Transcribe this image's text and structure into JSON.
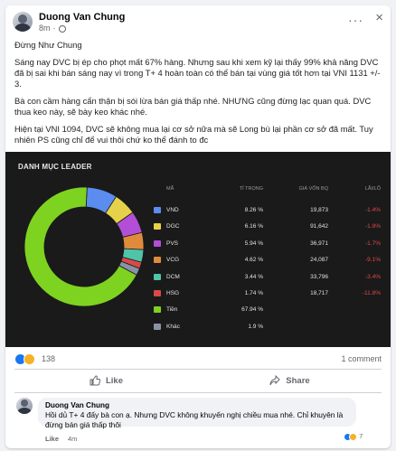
{
  "post": {
    "author": "Duong Van Chung",
    "time": "8m",
    "more": "···",
    "close": "×",
    "paragraphs": [
      "Đừng Như Chung",
      "Sáng nay DVC bị ép cho phọt mất 67% hàng. Nhưng sau khi xem kỹ lại thấy 99% khả năng DVC đã bị sai khi bán sáng nay vì trong T+ 4 hoàn toàn có thể bán tại vùng giá tốt hơn tại VNI 1131 +/- 3.",
      "Bà con cầm hàng cẩn thận bị sói lừa bán giá thấp nhé. NHƯNG cũng đừng lạc quan quá. DVC thua keo này, sẽ bày keo khác nhé.",
      "Hiện tại VNI 1094, DVC sẽ không mua lại cơ sở nữa mà sẽ Long bù lại phần cơ sở đã mất. Tuy nhiên PS cũng chỉ để vui thôi chứ ko thể đánh to đc"
    ]
  },
  "portfolio": {
    "title": "DANH MỤC LEADER",
    "headers": {
      "code": "MÃ",
      "weight": "TỈ TRỌNG",
      "price": "GIÁ VỐN BQ",
      "pl": "LÃI/LỖ"
    },
    "rows": [
      {
        "code": "VND",
        "weight": "8.26 %",
        "price": "19,873",
        "pl": "-1.4%",
        "color": "#5b8cf0"
      },
      {
        "code": "DGC",
        "weight": "6.16 %",
        "price": "91,642",
        "pl": "-1.8%",
        "color": "#e6d24a"
      },
      {
        "code": "PVS",
        "weight": "5.94 %",
        "price": "36,971",
        "pl": "-1.7%",
        "color": "#b24fd6"
      },
      {
        "code": "VCG",
        "weight": "4.62 %",
        "price": "24,087",
        "pl": "-9.1%",
        "color": "#e08a3c"
      },
      {
        "code": "DCM",
        "weight": "3.44 %",
        "price": "33,796",
        "pl": "-3.4%",
        "color": "#4fc4a8"
      },
      {
        "code": "HSG",
        "weight": "1.74 %",
        "price": "18,717",
        "pl": "-11.8%",
        "color": "#d84a4a"
      },
      {
        "code": "Tiền",
        "weight": "67.94 %",
        "price": "",
        "pl": "",
        "color": "#7ed321"
      },
      {
        "code": "Khác",
        "weight": "1.9 %",
        "price": "",
        "pl": "",
        "color": "#8a93a6"
      }
    ]
  },
  "chart_data": {
    "type": "pie",
    "title": "DANH MỤC LEADER",
    "categories": [
      "VND",
      "DGC",
      "PVS",
      "VCG",
      "DCM",
      "HSG",
      "Tiền",
      "Khác"
    ],
    "values": [
      8.26,
      6.16,
      5.94,
      4.62,
      3.44,
      1.74,
      67.94,
      1.9
    ],
    "colors": [
      "#5b8cf0",
      "#e6d24a",
      "#b24fd6",
      "#e08a3c",
      "#4fc4a8",
      "#d84a4a",
      "#7ed321",
      "#8a93a6"
    ]
  },
  "stats": {
    "reactions": "138",
    "comments": "1 comment"
  },
  "actions": {
    "like": "Like",
    "share": "Share"
  },
  "comment": {
    "author": "Duong Van Chung",
    "text": "Hồi dủ T+ 4 đấy bà con ạ. Nhưng DVC không khuyến nghị chiều mua nhé. Chỉ khuyên là đừng bán giá thấp thôi",
    "like": "Like",
    "time": "4m",
    "react_count": "7"
  }
}
